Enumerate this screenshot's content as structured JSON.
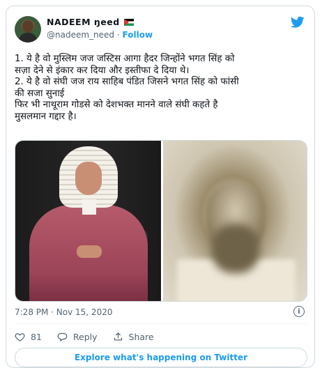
{
  "author": {
    "display_name": "NADEEM ŋeed",
    "handle": "@nadeem_need",
    "separator": "·",
    "follow_label": "Follow"
  },
  "tweet": {
    "lines": [
      "1. ये है वो मुस्लिम जज जस्टिस आगा हैदर जिन्होंने भगत सिंह को",
      "सज़ा देने से इंकार कर दिया और इस्तीफा दे दिया थे।",
      "2. ये है वो संघी जज राय साहिब पंडित जिसने भगत सिंह को फांसी",
      "की सजा सुनाई",
      "फिर भी नाथूराम गोडसे को देशभक्त मानने वाले संघी कहते है",
      "मुसलमान गद्दार है।"
    ]
  },
  "timestamp": "7:28 PM · Nov 15, 2020",
  "actions": {
    "like_count": "81",
    "reply_label": "Reply",
    "share_label": "Share"
  },
  "explore_label": "Explore what's happening on Twitter",
  "colors": {
    "accent": "#1d9bf0",
    "muted": "#536471",
    "border": "#cfd9de"
  },
  "icons": [
    "twitter-bird-icon",
    "info-icon",
    "heart-icon",
    "reply-icon",
    "share-icon"
  ]
}
